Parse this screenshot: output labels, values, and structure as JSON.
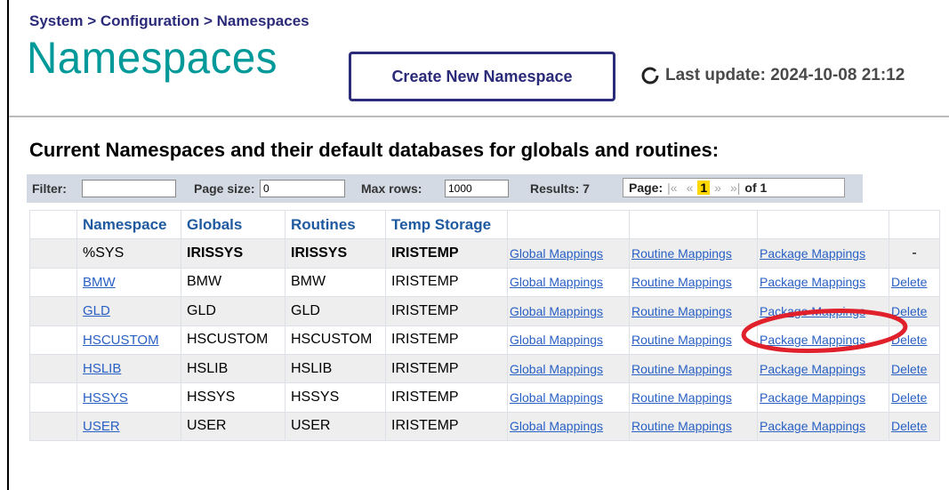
{
  "breadcrumb": "System > Configuration > Namespaces",
  "title": "Namespaces",
  "create_button": "Create New Namespace",
  "last_update": "Last update: 2024-10-08 21:12",
  "subtitle": "Current Namespaces and their default databases for globals and routines:",
  "toolbar": {
    "filter_label": "Filter:",
    "filter_value": "",
    "page_size_label": "Page size:",
    "page_size_value": "0",
    "max_rows_label": "Max rows:",
    "max_rows_value": "1000",
    "results_label": "Results: 7",
    "page_label": "Page:",
    "first": "|«",
    "prev": "«",
    "current_page": "1",
    "next": "»",
    "last": "»|",
    "of_label": "of 1"
  },
  "columns": [
    "Namespace",
    "Globals",
    "Routines",
    "Temp Storage"
  ],
  "link_labels": {
    "global": "Global Mappings",
    "routine": "Routine Mappings",
    "package": "Package Mappings",
    "delete": "Delete",
    "none": "-"
  },
  "rows": [
    {
      "namespace": "%SYS",
      "globals": "IRISSYS",
      "routines": "IRISSYS",
      "temp": "IRISTEMP"
    },
    {
      "namespace": "BMW",
      "globals": "BMW",
      "routines": "BMW",
      "temp": "IRISTEMP"
    },
    {
      "namespace": "GLD",
      "globals": "GLD",
      "routines": "GLD",
      "temp": "IRISTEMP"
    },
    {
      "namespace": "HSCUSTOM",
      "globals": "HSCUSTOM",
      "routines": "HSCUSTOM",
      "temp": "IRISTEMP"
    },
    {
      "namespace": "HSLIB",
      "globals": "HSLIB",
      "routines": "HSLIB",
      "temp": "IRISTEMP"
    },
    {
      "namespace": "HSSYS",
      "globals": "HSSYS",
      "routines": "HSSYS",
      "temp": "IRISTEMP"
    },
    {
      "namespace": "USER",
      "globals": "USER",
      "routines": "USER",
      "temp": "IRISTEMP"
    }
  ],
  "colors": {
    "title": "#00999a",
    "link": "#2860c4",
    "header": "#1f5aa0",
    "annotation": "#e0202a",
    "pager_highlight": "#ffd800"
  }
}
